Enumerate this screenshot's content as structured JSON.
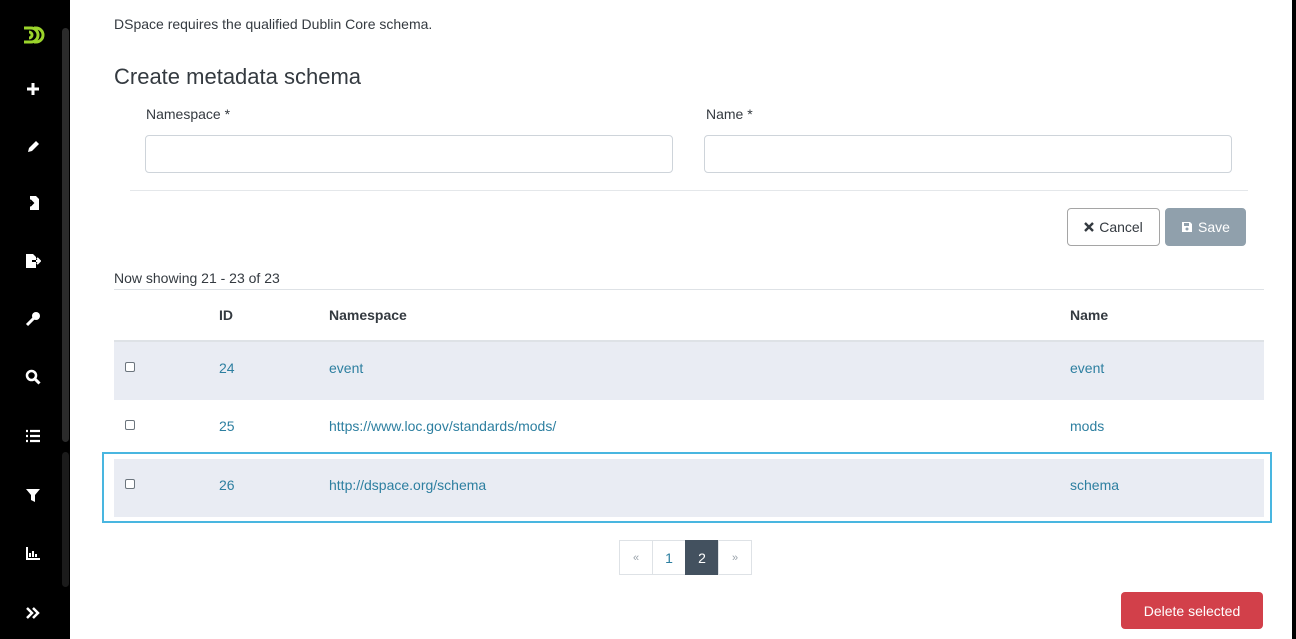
{
  "intro_text": "DSpace requires the qualified Dublin Core schema.",
  "form": {
    "title": "Create metadata schema",
    "namespace_label": "Namespace *",
    "namespace_value": "",
    "name_label": "Name *",
    "name_value": "",
    "cancel_label": "Cancel",
    "save_label": "Save"
  },
  "showing_text": "Now showing 21 - 23 of 23",
  "table": {
    "headers": {
      "id": "ID",
      "namespace": "Namespace",
      "name": "Name"
    },
    "rows": [
      {
        "id": "24",
        "namespace": "event",
        "name": "event"
      },
      {
        "id": "25",
        "namespace": "https://www.loc.gov/standards/mods/",
        "name": "mods"
      },
      {
        "id": "26",
        "namespace": "http://dspace.org/schema",
        "name": "schema"
      }
    ]
  },
  "pagination": {
    "prev": "«",
    "pages": [
      "1",
      "2"
    ],
    "active": "2",
    "next": "»"
  },
  "delete_label": "Delete selected",
  "sidebar": {
    "icons": [
      "dspace-logo-icon",
      "plus-icon",
      "pencil-icon",
      "import-icon",
      "export-icon",
      "key-icon",
      "search-icon",
      "list-icon",
      "filter-icon",
      "chart-icon",
      "expand-icon"
    ]
  },
  "colors": {
    "sidebar_bg": "#000000",
    "logo_green": "#9bd42b",
    "link": "#2d7fa0",
    "row_shade": "#e9ecf3",
    "focus_outline": "#49b6e0",
    "delete_button": "#d2404a",
    "save_button": "#90a0ac",
    "active_page": "#43515f"
  }
}
